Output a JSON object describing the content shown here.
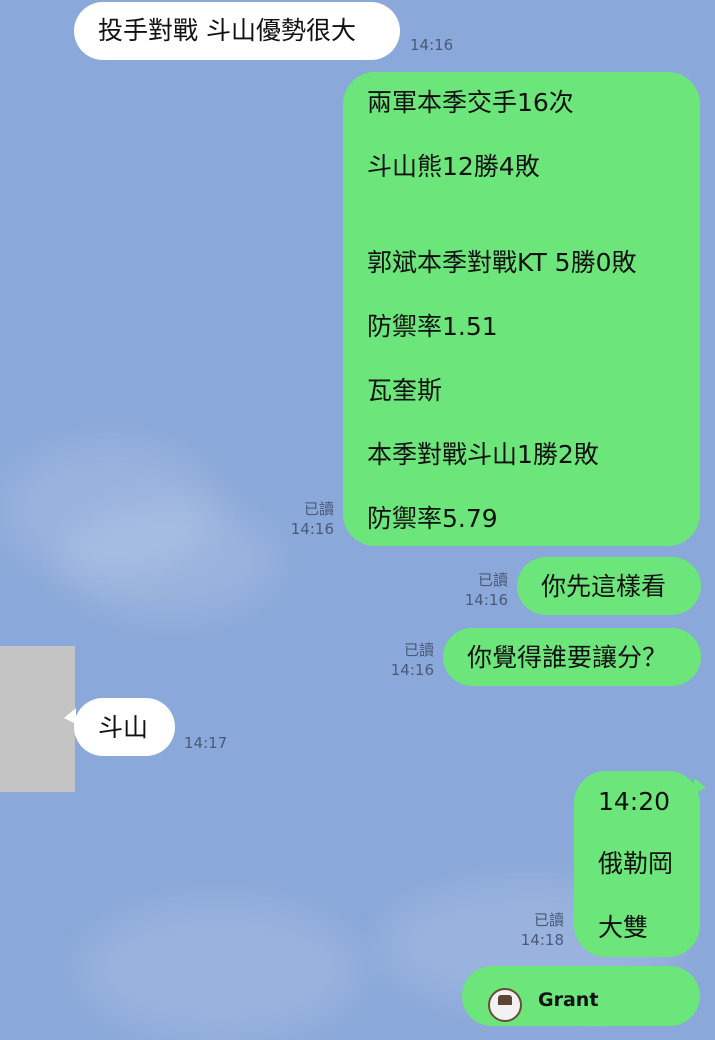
{
  "messages": [
    {
      "side": "in",
      "text": "投手對戰 斗山優勢很大",
      "time": "14:16"
    },
    {
      "side": "out",
      "read": "已讀",
      "time": "14:16",
      "lines": [
        "兩軍本季交手16次",
        "斗山熊12勝4敗",
        "",
        "郭斌本季對戰KT 5勝0敗",
        "防禦率1.51",
        "瓦奎斯",
        "本季對戰斗山1勝2敗",
        "防禦率5.79"
      ]
    },
    {
      "side": "out",
      "read": "已讀",
      "time": "14:16",
      "text": "你先這樣看"
    },
    {
      "side": "out",
      "read": "已讀",
      "time": "14:16",
      "text": "你覺得誰要讓分？"
    },
    {
      "side": "in",
      "text": "斗山",
      "time": "14:17"
    },
    {
      "side": "out",
      "read": "已讀",
      "time": "14:18",
      "lines": [
        "14:20",
        "俄勒岡",
        "大雙"
      ]
    },
    {
      "side": "out",
      "partial_name": "Grant"
    }
  ]
}
